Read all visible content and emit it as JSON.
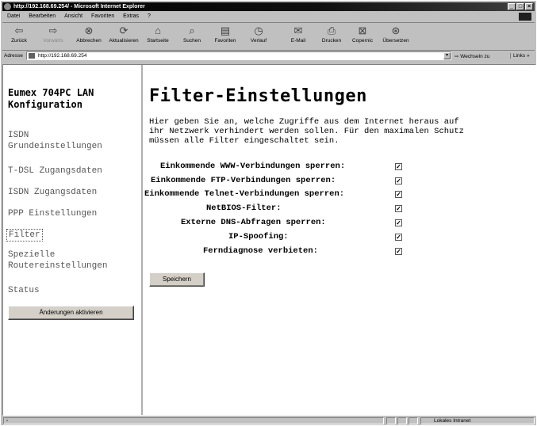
{
  "window": {
    "title": "http://192.168.69.254/ - Microsoft Internet Explorer"
  },
  "menu": [
    "Datei",
    "Bearbeiten",
    "Ansicht",
    "Favoriten",
    "Extras",
    "?"
  ],
  "toolbar": [
    {
      "label": "Zurück",
      "icon": "back-arrow-icon"
    },
    {
      "label": "Vorwärts",
      "icon": "forward-arrow-icon"
    },
    {
      "label": "Abbrechen",
      "icon": "stop-icon"
    },
    {
      "label": "Aktualisieren",
      "icon": "refresh-icon"
    },
    {
      "label": "Startseite",
      "icon": "home-icon"
    },
    {
      "label": "Suchen",
      "icon": "search-icon"
    },
    {
      "label": "Favoriten",
      "icon": "favorites-icon"
    },
    {
      "label": "Verlauf",
      "icon": "history-icon"
    },
    {
      "label": "E-Mail",
      "icon": "mail-icon"
    },
    {
      "label": "Drucken",
      "icon": "print-icon"
    },
    {
      "label": "Copernic",
      "icon": "copernic-icon"
    },
    {
      "label": "Übersetzen",
      "icon": "translate-icon"
    }
  ],
  "address": {
    "label": "Adresse",
    "url": "http://192.168.69.254",
    "go": "Wechseln zu",
    "links": "Links »"
  },
  "sidebar": {
    "title_line1": "Eumex 704PC LAN",
    "title_line2": "Konfiguration",
    "items": [
      {
        "l1": "ISDN",
        "l2": "Grundeinstellungen"
      },
      {
        "l1": "T-DSL Zugangsdaten"
      },
      {
        "l1": "ISDN Zugangsdaten"
      },
      {
        "l1": "PPP Einstellungen"
      },
      {
        "l1": "Filter"
      },
      {
        "l1": "Spezielle",
        "l2": "Routereinstellungen"
      },
      {
        "l1": "Status"
      }
    ],
    "activate_button": "Änderungen aktivieren"
  },
  "main": {
    "heading": "Filter-Einstellungen",
    "intro": "Hier geben Sie an, welche Zugriffe aus dem Internet heraus auf\nihr Netzwerk verhindert werden sollen. Für den maximalen Schutz\nmüssen alle Filter eingeschaltet sein.",
    "filters": [
      {
        "label": "Einkommende WWW-Verbindungen sperren:",
        "checked": true
      },
      {
        "label": "Einkommende FTP-Verbindungen sperren:",
        "checked": true
      },
      {
        "label": "Einkommende Telnet-Verbindungen sperren:",
        "checked": true
      },
      {
        "label": "NetBIOS-Filter:",
        "checked": true
      },
      {
        "label": "Externe DNS-Abfragen sperren:",
        "checked": true
      },
      {
        "label": "IP-Spoofing:",
        "checked": true
      },
      {
        "label": "Ferndiagnose verbieten:",
        "checked": true
      }
    ],
    "save_button": "Speichern"
  },
  "status": {
    "zone": "Lokales Intranet"
  }
}
